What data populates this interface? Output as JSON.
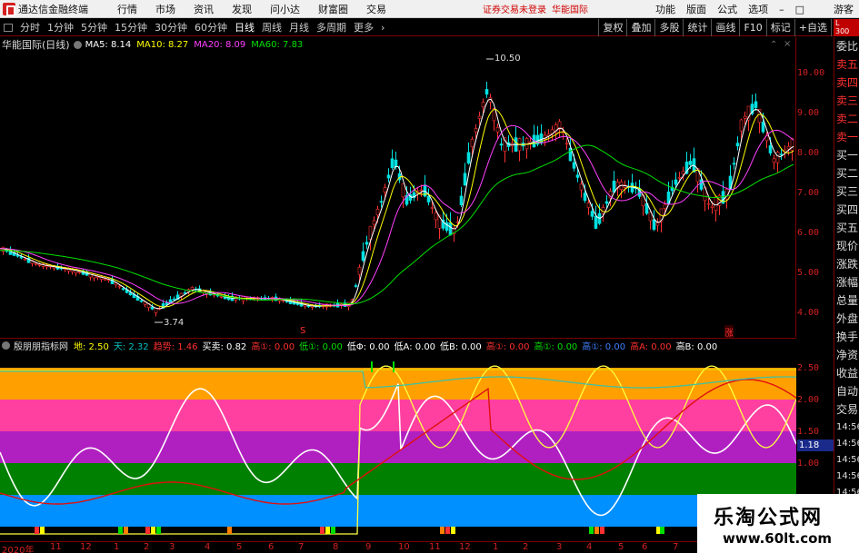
{
  "menubar": {
    "app_title": "通达信金融终端",
    "items": [
      "行情",
      "市场",
      "资讯",
      "发现",
      "问小达",
      "财富圈",
      "交易"
    ],
    "warning": "证券交易未登录",
    "stock_link": "华能国际",
    "right_items": [
      "功能",
      "版面",
      "公式",
      "选项"
    ],
    "guest": "游客"
  },
  "toolbar": {
    "periods": [
      "分时",
      "1分钟",
      "5分钟",
      "15分钟",
      "30分钟",
      "60分钟",
      "日线",
      "周线",
      "月线",
      "多周期",
      "更多"
    ],
    "active_period": "日线",
    "tools": [
      "复权",
      "叠加",
      "多股",
      "统计",
      "画线",
      "F10",
      "标记",
      "+自选",
      "返回"
    ]
  },
  "main": {
    "stock": "华能国际(日线)",
    "ma5": "MA5: 8.14",
    "ma10": "MA10: 8.27",
    "ma20": "MA20: 8.09",
    "ma60": "MA60: 7.83",
    "high_label": "10.50",
    "low_label": "3.74",
    "mark_s": "S",
    "mark_zhang": "涨",
    "yaxis": [
      "10.00",
      "9.00",
      "8.00",
      "7.00",
      "6.00",
      "5.00",
      "4.00"
    ]
  },
  "side": {
    "head": "L\n300",
    "items": [
      "委比",
      "卖五",
      "卖四",
      "卖三",
      "卖二",
      "卖一",
      "买一",
      "买二",
      "买三",
      "买四",
      "买五",
      "现价",
      "涨跌",
      "涨幅",
      "总量",
      "外盘",
      "换手",
      "净资",
      "收益",
      "自动",
      "交易",
      "14:56",
      "14:56",
      "14:56",
      "14:56",
      "14:56",
      "14:56",
      "14:56",
      "14:56"
    ]
  },
  "indicator": {
    "title": "殷朋朋指标网",
    "values": [
      {
        "text": "地: 2.50",
        "color": "#ffff00"
      },
      {
        "text": "天: 2.32",
        "color": "#00c0c0"
      },
      {
        "text": "趋势: 1.46",
        "color": "#ff3030"
      },
      {
        "text": "买卖: 0.82",
        "color": "#ffffff"
      },
      {
        "text": "高①: 0.00",
        "color": "#ff3030"
      },
      {
        "text": "低①: 0.00",
        "color": "#00e000"
      },
      {
        "text": "低Φ: 0.00",
        "color": "#ffffff"
      },
      {
        "text": "低A: 0.00",
        "color": "#ffffff"
      },
      {
        "text": "低B: 0.00",
        "color": "#ffffff"
      },
      {
        "text": "高①: 0.00",
        "color": "#ff3030"
      },
      {
        "text": "高①: 0.00",
        "color": "#00e000"
      },
      {
        "text": "高①: 0.00",
        "color": "#4080ff"
      },
      {
        "text": "高A: 0.00",
        "color": "#ff3030"
      },
      {
        "text": "高B: 0.00",
        "color": "#ffffff"
      }
    ],
    "yaxis": [
      "2.50",
      "2.00",
      "1.50",
      "1.00"
    ],
    "current_value": "1.18",
    "colors": {
      "orange": "#ffa000",
      "pink": "#ff40a0",
      "purple": "#b020c0",
      "green": "#008000",
      "blue": "#0090ff"
    }
  },
  "xaxis": [
    "2020年",
    "11",
    "12",
    "1",
    "2",
    "3",
    "4",
    "5",
    "6",
    "7",
    "8",
    "9",
    "10",
    "11",
    "12",
    "1",
    "2",
    "3",
    "4",
    "5",
    "6",
    "7"
  ],
  "watermark": {
    "title": "乐淘公式网",
    "url": "www.60lt.com"
  }
}
